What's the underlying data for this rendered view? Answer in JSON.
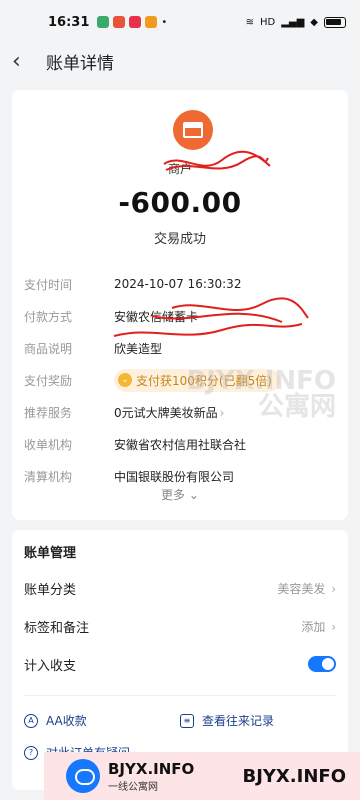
{
  "status_bar": {
    "time": "16:31",
    "signal_text": "HD",
    "dot": "•"
  },
  "header": {
    "title": "账单详情"
  },
  "merchant": {
    "name": "商户",
    "amount": "-600.00",
    "status": "交易成功"
  },
  "details": [
    {
      "label": "支付时间",
      "value": "2024-10-07 16:30:32"
    },
    {
      "label": "付款方式",
      "value": "安徽农信储蓄卡"
    },
    {
      "label": "商品说明",
      "value": "欣美造型"
    },
    {
      "label": "支付奖励",
      "value": "支付获100积分(已翻5倍)"
    },
    {
      "label": "推荐服务",
      "value": "0元试大牌美妆新品"
    },
    {
      "label": "收单机构",
      "value": "安徽省农村信用社联合社"
    },
    {
      "label": "清算机构",
      "value": "中国银联股份有限公司"
    }
  ],
  "more": {
    "label": "更多"
  },
  "manage": {
    "title": "账单管理",
    "category": {
      "label": "账单分类",
      "value": "美容美发"
    },
    "tags": {
      "label": "标签和备注",
      "value": "添加"
    },
    "income": {
      "label": "计入收支",
      "enabled": true
    },
    "aa": {
      "label": "AA收款"
    },
    "history": {
      "label": "查看往来记录"
    },
    "question": {
      "label": "对此订单有疑问"
    }
  },
  "watermark": {
    "line1": "BJYX.INFO",
    "line2": "公寓网"
  },
  "banner": {
    "site": "BJYX.INFO",
    "tagline": "一线公寓网",
    "big": "BJYX.INFO"
  },
  "colors": {
    "accent": "#1677ff",
    "merchant_icon": "#ef6a33",
    "reward": "#c98418",
    "link": "#1c3f8a",
    "scribble": "#e0201c"
  }
}
